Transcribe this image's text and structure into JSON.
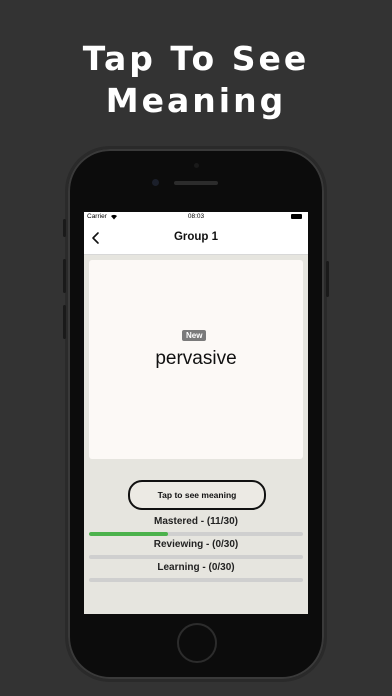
{
  "headline": {
    "line1": "Tap To See",
    "line2": "Meaning"
  },
  "status_bar": {
    "carrier": "Carrier",
    "time": "08:03"
  },
  "nav": {
    "title": "Group 1"
  },
  "card": {
    "badge": "New",
    "word": "pervasive"
  },
  "tap_button": {
    "label": "Tap to see meaning"
  },
  "progress": [
    {
      "label": "Mastered - (11/30)",
      "fraction": 0.367,
      "color": "#4cb24c"
    },
    {
      "label": "Reviewing - (0/30)",
      "fraction": 0.0,
      "color": "#4cb24c"
    },
    {
      "label": "Learning - (0/30)",
      "fraction": 0.0,
      "color": "#4cb24c"
    }
  ]
}
